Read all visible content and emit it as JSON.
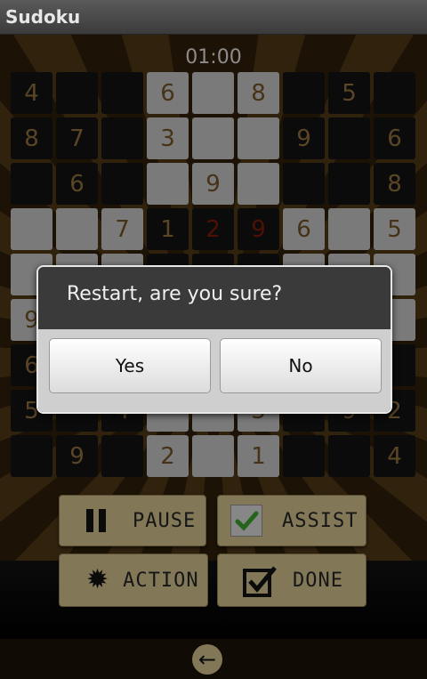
{
  "app": {
    "title": "Sudoku"
  },
  "timer": "01:00",
  "board": {
    "rows": [
      [
        {
          "v": "4",
          "s": "dark"
        },
        {
          "v": "",
          "s": "dark"
        },
        {
          "v": "",
          "s": "dark"
        },
        {
          "v": "6",
          "s": "light"
        },
        {
          "v": "",
          "s": "light"
        },
        {
          "v": "8",
          "s": "light"
        },
        {
          "v": "",
          "s": "dark"
        },
        {
          "v": "5",
          "s": "dark"
        },
        {
          "v": "",
          "s": "dark"
        }
      ],
      [
        {
          "v": "8",
          "s": "dark"
        },
        {
          "v": "7",
          "s": "dark"
        },
        {
          "v": "",
          "s": "dark"
        },
        {
          "v": "3",
          "s": "light"
        },
        {
          "v": "",
          "s": "light"
        },
        {
          "v": "",
          "s": "light"
        },
        {
          "v": "9",
          "s": "dark"
        },
        {
          "v": "",
          "s": "dark"
        },
        {
          "v": "6",
          "s": "dark"
        }
      ],
      [
        {
          "v": "",
          "s": "dark"
        },
        {
          "v": "6",
          "s": "dark"
        },
        {
          "v": "",
          "s": "dark"
        },
        {
          "v": "",
          "s": "light"
        },
        {
          "v": "9",
          "s": "light"
        },
        {
          "v": "",
          "s": "light"
        },
        {
          "v": "",
          "s": "dark"
        },
        {
          "v": "",
          "s": "dark"
        },
        {
          "v": "8",
          "s": "dark"
        }
      ],
      [
        {
          "v": "",
          "s": "light"
        },
        {
          "v": "",
          "s": "light"
        },
        {
          "v": "7",
          "s": "light"
        },
        {
          "v": "1",
          "s": "dark"
        },
        {
          "v": "2",
          "s": "dark red"
        },
        {
          "v": "9",
          "s": "dark red"
        },
        {
          "v": "6",
          "s": "light"
        },
        {
          "v": "",
          "s": "light"
        },
        {
          "v": "5",
          "s": "light"
        }
      ],
      [
        {
          "v": "",
          "s": "light"
        },
        {
          "v": "",
          "s": "light"
        },
        {
          "v": "",
          "s": "light"
        },
        {
          "v": "",
          "s": "dark"
        },
        {
          "v": "",
          "s": "dark"
        },
        {
          "v": "",
          "s": "dark"
        },
        {
          "v": "",
          "s": "light"
        },
        {
          "v": "",
          "s": "light"
        },
        {
          "v": "",
          "s": "light"
        }
      ],
      [
        {
          "v": "9",
          "s": "light"
        },
        {
          "v": "",
          "s": "light"
        },
        {
          "v": "",
          "s": "light"
        },
        {
          "v": "",
          "s": "dark"
        },
        {
          "v": "",
          "s": "dark"
        },
        {
          "v": "",
          "s": "dark"
        },
        {
          "v": "",
          "s": "light"
        },
        {
          "v": "",
          "s": "light"
        },
        {
          "v": "",
          "s": "light"
        }
      ],
      [
        {
          "v": "6",
          "s": "dark"
        },
        {
          "v": "",
          "s": "dark"
        },
        {
          "v": "",
          "s": "dark"
        },
        {
          "v": "",
          "s": "light"
        },
        {
          "v": "",
          "s": "light"
        },
        {
          "v": "",
          "s": "light"
        },
        {
          "v": "",
          "s": "dark"
        },
        {
          "v": "",
          "s": "dark"
        },
        {
          "v": "",
          "s": "dark"
        }
      ],
      [
        {
          "v": "5",
          "s": "dark"
        },
        {
          "v": "",
          "s": "dark"
        },
        {
          "v": "4",
          "s": "dark"
        },
        {
          "v": "",
          "s": "light"
        },
        {
          "v": "",
          "s": "light"
        },
        {
          "v": "3",
          "s": "light"
        },
        {
          "v": "",
          "s": "dark"
        },
        {
          "v": "9",
          "s": "dark"
        },
        {
          "v": "2",
          "s": "dark"
        }
      ],
      [
        {
          "v": "",
          "s": "dark"
        },
        {
          "v": "9",
          "s": "dark"
        },
        {
          "v": "",
          "s": "dark"
        },
        {
          "v": "2",
          "s": "light"
        },
        {
          "v": "",
          "s": "light"
        },
        {
          "v": "1",
          "s": "light"
        },
        {
          "v": "",
          "s": "dark"
        },
        {
          "v": "",
          "s": "dark"
        },
        {
          "v": "4",
          "s": "dark"
        }
      ]
    ]
  },
  "controls": {
    "pause": "PAUSE",
    "assist": "ASSIST",
    "action": "ACTION",
    "done": "DONE"
  },
  "dialog": {
    "message": "Restart, are you sure?",
    "yes": "Yes",
    "no": "No"
  }
}
